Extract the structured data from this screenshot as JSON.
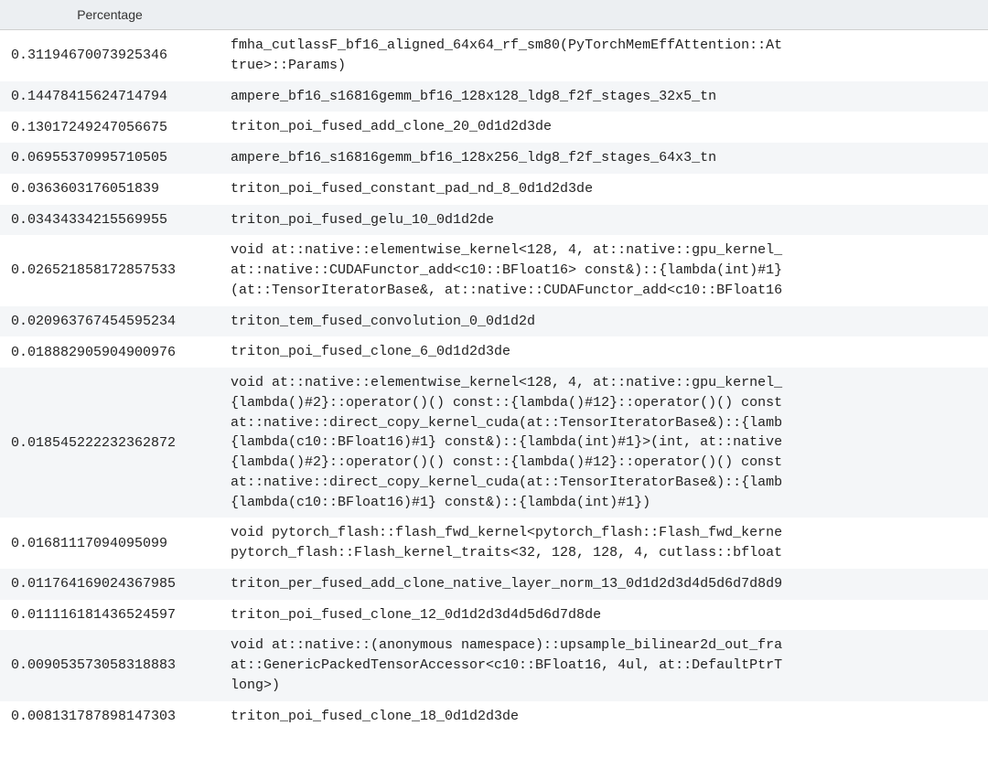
{
  "table": {
    "columns": {
      "percentage": "Percentage",
      "name": ""
    },
    "rows": [
      {
        "percentage": "0.31194670073925346",
        "name": "fmha_cutlassF_bf16_aligned_64x64_rf_sm80(PyTorchMemEffAttention::At\ntrue>::Params)"
      },
      {
        "percentage": "0.14478415624714794",
        "name": "ampere_bf16_s16816gemm_bf16_128x128_ldg8_f2f_stages_32x5_tn"
      },
      {
        "percentage": "0.13017249247056675",
        "name": "triton_poi_fused_add_clone_20_0d1d2d3de"
      },
      {
        "percentage": "0.06955370995710505",
        "name": "ampere_bf16_s16816gemm_bf16_128x256_ldg8_f2f_stages_64x3_tn"
      },
      {
        "percentage": "0.0363603176051839",
        "name": "triton_poi_fused_constant_pad_nd_8_0d1d2d3de"
      },
      {
        "percentage": "0.03434334215569955",
        "name": "triton_poi_fused_gelu_10_0d1d2de"
      },
      {
        "percentage": "0.026521858172857533",
        "name": "void at::native::elementwise_kernel<128, 4, at::native::gpu_kernel_\nat::native::CUDAFunctor_add<c10::BFloat16> const&)::{lambda(int)#1}\n(at::TensorIteratorBase&, at::native::CUDAFunctor_add<c10::BFloat16"
      },
      {
        "percentage": "0.020963767454595234",
        "name": "triton_tem_fused_convolution_0_0d1d2d"
      },
      {
        "percentage": "0.018882905904900976",
        "name": "triton_poi_fused_clone_6_0d1d2d3de"
      },
      {
        "percentage": "0.018545222232362872",
        "name": "void at::native::elementwise_kernel<128, 4, at::native::gpu_kernel_\n{lambda()#2}::operator()() const::{lambda()#12}::operator()() const\nat::native::direct_copy_kernel_cuda(at::TensorIteratorBase&)::{lamb\n{lambda(c10::BFloat16)#1} const&)::{lambda(int)#1}>(int, at::native\n{lambda()#2}::operator()() const::{lambda()#12}::operator()() const\nat::native::direct_copy_kernel_cuda(at::TensorIteratorBase&)::{lamb\n{lambda(c10::BFloat16)#1} const&)::{lambda(int)#1})"
      },
      {
        "percentage": "0.01681117094095099",
        "name": "void pytorch_flash::flash_fwd_kernel<pytorch_flash::Flash_fwd_kerne\npytorch_flash::Flash_kernel_traits<32, 128, 128, 4, cutlass::bfloat"
      },
      {
        "percentage": "0.011764169024367985",
        "name": "triton_per_fused_add_clone_native_layer_norm_13_0d1d2d3d4d5d6d7d8d9"
      },
      {
        "percentage": "0.011116181436524597",
        "name": "triton_poi_fused_clone_12_0d1d2d3d4d5d6d7d8de"
      },
      {
        "percentage": "0.009053573058318883",
        "name": "void at::native::(anonymous namespace)::upsample_bilinear2d_out_fra\nat::GenericPackedTensorAccessor<c10::BFloat16, 4ul, at::DefaultPtrT\nlong>)"
      },
      {
        "percentage": "0.008131787898147303",
        "name": "triton_poi_fused_clone_18_0d1d2d3de"
      }
    ]
  }
}
